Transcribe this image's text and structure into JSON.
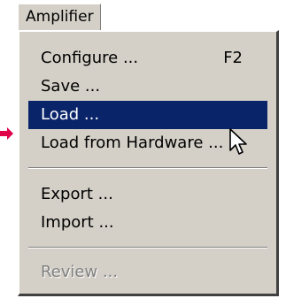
{
  "menubar": {
    "title": "Amplifier"
  },
  "menu": {
    "items": [
      {
        "label": "Configure ...",
        "shortcut": "F2",
        "state": "normal"
      },
      {
        "label": "Save ...",
        "shortcut": "",
        "state": "normal"
      },
      {
        "label": "Load ...",
        "shortcut": "",
        "state": "highlighted"
      },
      {
        "label": "Load from Hardware ...",
        "shortcut": "",
        "state": "normal"
      },
      {
        "label": "Export ...",
        "shortcut": "",
        "state": "normal"
      },
      {
        "label": "Import ...",
        "shortcut": "",
        "state": "normal"
      },
      {
        "label": "Review ...",
        "shortcut": "",
        "state": "disabled"
      }
    ]
  },
  "colors": {
    "menu_background": "#d4d0c8",
    "highlight": "#0a246a",
    "pointer_arrow": "#e0004a"
  },
  "icons": {
    "pointer": "arrow-pointer-icon",
    "cursor": "mouse-cursor-icon"
  }
}
